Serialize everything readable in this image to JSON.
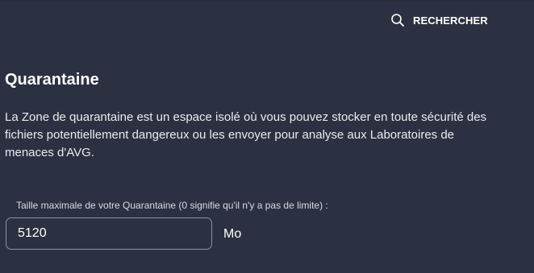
{
  "header": {
    "search_label": "RECHERCHER",
    "search_icon": "search-icon"
  },
  "main": {
    "title": "Quarantaine",
    "description": "La Zone de quarantaine est un espace isolé où vous pouvez stocker en toute sécurité des fichiers potentiellement dangereux ou les envoyer pour analyse aux Laboratoires de menaces d'AVG.",
    "max_size": {
      "label": "Taille maximale de votre Quarantaine (0 signifie qu'il n'y a pas de limite) :",
      "value": "5120",
      "unit": "Mo"
    }
  },
  "colors": {
    "background": "#2b3140",
    "text": "#ffffff",
    "input_border": "#8a90a0"
  }
}
